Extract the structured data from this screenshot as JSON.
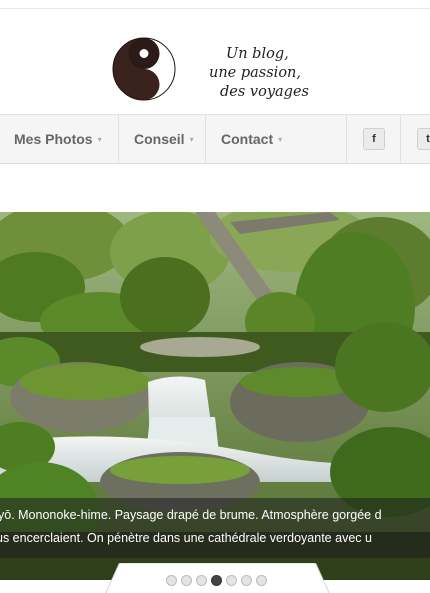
{
  "header": {
    "logo_icon": "yin-yang-icon",
    "tagline": [
      "Un blog,",
      "une passion,",
      "des voyages"
    ]
  },
  "nav": {
    "items": [
      {
        "label": "Mes Photos",
        "caret": "▾"
      },
      {
        "label": "Conseil",
        "caret": "▾"
      },
      {
        "label": "Contact",
        "caret": "▾"
      }
    ],
    "social": [
      {
        "icon": "facebook-icon",
        "glyph": "f"
      },
      {
        "icon": "twitter-icon",
        "glyph": "t"
      }
    ]
  },
  "slider": {
    "caption_lines": [
      "yō. Mononoke-hime. Paysage drapé de brume. Atmosphère gorgée d",
      "us encerclaient. On pénètre dans une cathédrale verdoyante avec u"
    ],
    "dots": 7,
    "active_dot": 4
  },
  "colors": {
    "nav_text": "#666666",
    "moss": "#5f8a2c",
    "caption_bg": "rgba(30,30,30,0.55)"
  }
}
